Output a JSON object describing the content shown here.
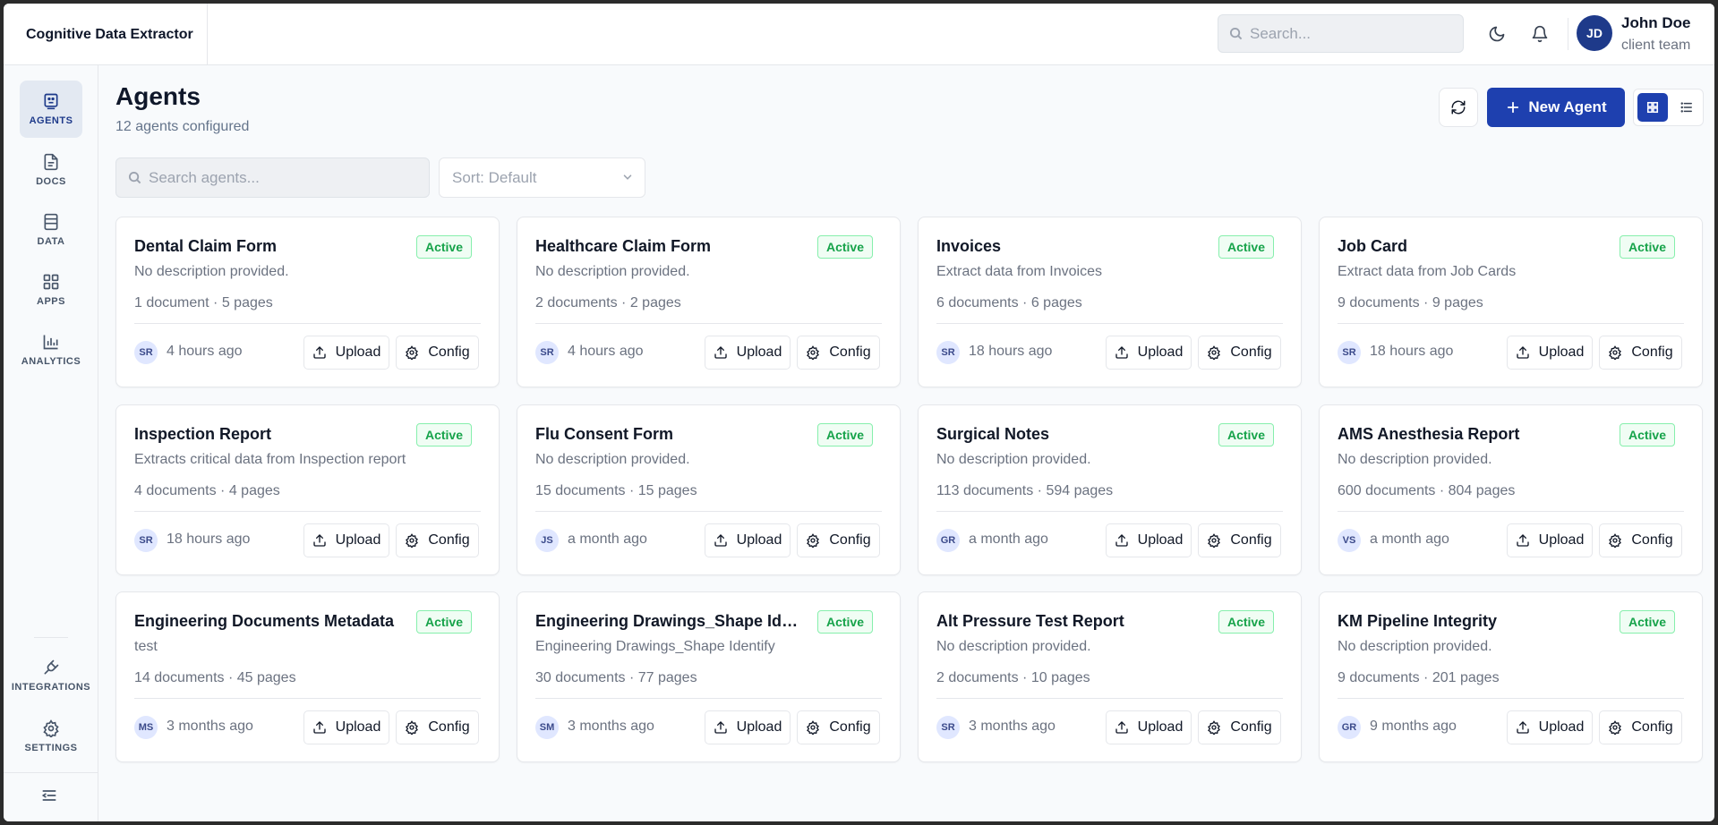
{
  "app": {
    "title": "Cognitive Data Extractor"
  },
  "header": {
    "search_placeholder": "Search...",
    "user": {
      "initials": "JD",
      "name": "John Doe",
      "team": "client team"
    }
  },
  "sidebar": {
    "items": [
      {
        "label": "AGENTS",
        "icon": "agents-icon",
        "active": true
      },
      {
        "label": "DOCS",
        "icon": "document-icon",
        "active": false
      },
      {
        "label": "DATA",
        "icon": "data-icon",
        "active": false
      },
      {
        "label": "APPS",
        "icon": "apps-grid-icon",
        "active": false
      },
      {
        "label": "ANALYTICS",
        "icon": "bar-chart-icon",
        "active": false
      }
    ],
    "bottom_items": [
      {
        "label": "INTEGRATIONS",
        "icon": "plug-icon"
      },
      {
        "label": "SETTINGS",
        "icon": "gear-icon"
      }
    ]
  },
  "main": {
    "title": "Agents",
    "subtitle": "12 agents configured",
    "new_agent_label": "New Agent",
    "search_placeholder": "Search agents...",
    "sort_value": "Sort: Default",
    "upload_label": "Upload",
    "config_label": "Config",
    "accent_color": "#1e40af",
    "status_color": "#16a34a"
  },
  "agents": [
    {
      "name": "Dental Claim Form",
      "status": "Active",
      "description": "No description provided.",
      "stats": "1 document · 5 pages",
      "initials": "SR",
      "updated": "4 hours ago"
    },
    {
      "name": "Healthcare Claim Form",
      "status": "Active",
      "description": "No description provided.",
      "stats": "2 documents · 2 pages",
      "initials": "SR",
      "updated": "4 hours ago"
    },
    {
      "name": "Invoices",
      "status": "Active",
      "description": "Extract data from Invoices",
      "stats": "6 documents · 6 pages",
      "initials": "SR",
      "updated": "18 hours ago"
    },
    {
      "name": "Job Card",
      "status": "Active",
      "description": "Extract data from Job Cards",
      "stats": "9 documents · 9 pages",
      "initials": "SR",
      "updated": "18 hours ago"
    },
    {
      "name": "Inspection Report",
      "status": "Active",
      "description": "Extracts critical data from Inspection report",
      "stats": "4 documents · 4 pages",
      "initials": "SR",
      "updated": "18 hours ago"
    },
    {
      "name": "Flu Consent Form",
      "status": "Active",
      "description": "No description provided.",
      "stats": "15 documents · 15 pages",
      "initials": "JS",
      "updated": "a month ago"
    },
    {
      "name": "Surgical Notes",
      "status": "Active",
      "description": "No description provided.",
      "stats": "113 documents · 594 pages",
      "initials": "GR",
      "updated": "a month ago"
    },
    {
      "name": "AMS Anesthesia Report",
      "status": "Active",
      "description": "No description provided.",
      "stats": "600 documents · 804 pages",
      "initials": "VS",
      "updated": "a month ago"
    },
    {
      "name": "Engineering Documents Metadata",
      "status": "Active",
      "description": "test",
      "stats": "14 documents · 45 pages",
      "initials": "MS",
      "updated": "3 months ago"
    },
    {
      "name": "Engineering Drawings_Shape Ide...",
      "status": "Active",
      "description": "Engineering Drawings_Shape Identify",
      "stats": "30 documents · 77 pages",
      "initials": "SM",
      "updated": "3 months ago"
    },
    {
      "name": "Alt Pressure Test Report",
      "status": "Active",
      "description": "No description provided.",
      "stats": "2 documents · 10 pages",
      "initials": "SR",
      "updated": "3 months ago"
    },
    {
      "name": "KM Pipeline Integrity",
      "status": "Active",
      "description": "No description provided.",
      "stats": "9 documents · 201 pages",
      "initials": "GR",
      "updated": "9 months ago"
    }
  ]
}
